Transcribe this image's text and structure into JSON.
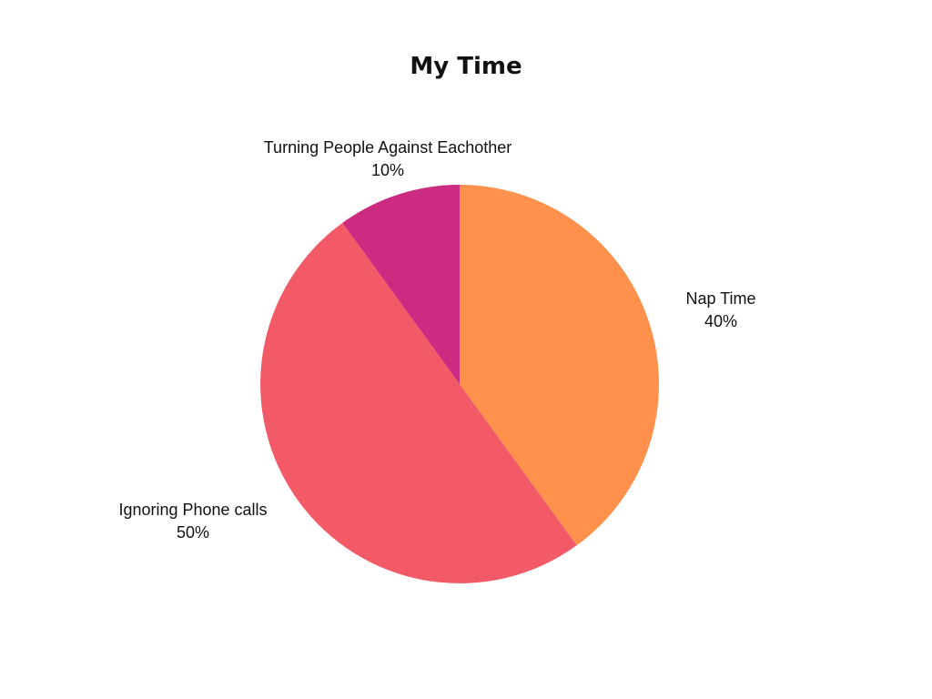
{
  "chart_data": {
    "type": "pie",
    "title": "My Time",
    "slices": [
      {
        "label": "Nap Time",
        "value": 40,
        "percent_label": "40%",
        "color": "#FF914D"
      },
      {
        "label": "Ignoring Phone calls",
        "value": 50,
        "percent_label": "50%",
        "color": "#F25A67"
      },
      {
        "label": "Turning People Against Eachother",
        "value": 10,
        "percent_label": "10%",
        "color": "#CB2B81"
      }
    ],
    "start": "top",
    "direction": "clockwise",
    "legend": "none",
    "labels": "outside"
  }
}
